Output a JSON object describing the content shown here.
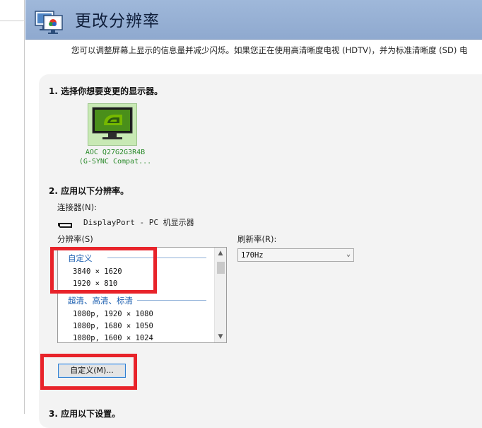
{
  "header": {
    "title": "更改分辨率",
    "icon": "display-settings-icon"
  },
  "description": "您可以调整屏幕上显示的信息量并减少闪烁。如果您正在使用高清晰度电视 (HDTV)，并为标准清晰度 (SD) 电",
  "section1": {
    "heading": "1. 选择你想要变更的显示器。",
    "monitor": {
      "icon": "nvidia-monitor-icon",
      "name_line1": "AOC Q27G2G3R4B",
      "name_line2": "(G-SYNC Compat..."
    }
  },
  "section2": {
    "heading": "2. 应用以下分辨率。",
    "connector_label": "连接器(N):",
    "connector_icon": "displayport-icon",
    "connector_value": "DisplayPort - PC 机显示器",
    "resolution_label": "分辨率(S)",
    "refresh_label": "刷新率(R):",
    "refresh_value": "170Hz",
    "groups": [
      {
        "title": "自定义",
        "items": [
          "3840 × 1620",
          "1920 × 810"
        ]
      },
      {
        "title": "超清、高清、标清",
        "items": [
          "1080p, 1920 × 1080",
          "1080p, 1680 × 1050",
          "1080p, 1600 × 1024"
        ]
      }
    ],
    "custom_button": "自定义(M)..."
  },
  "section3": {
    "heading": "3. 应用以下设置。"
  },
  "colors": {
    "header_bg": "#9fb8da",
    "highlight": "#e8232a",
    "group_title": "#1c5fb0",
    "monitor_caption": "#2a8a2a"
  }
}
